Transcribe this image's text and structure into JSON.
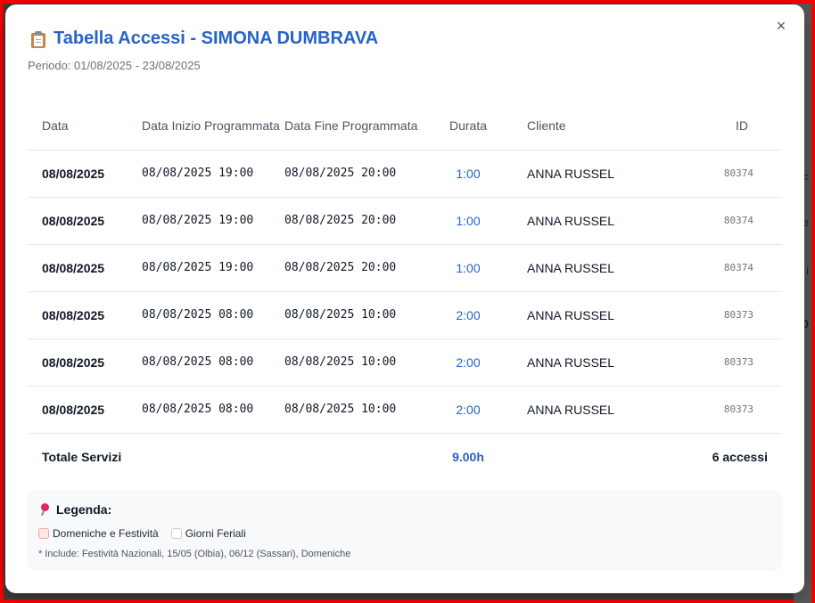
{
  "modal": {
    "title": "Tabella Accessi - SIMONA DUMBRAVA",
    "subtitle": "Periodo: 01/08/2025 - 23/08/2025",
    "close_label": "×"
  },
  "table": {
    "headers": {
      "date": "Data",
      "start": "Data Inizio Programmata",
      "end": "Data Fine Programmata",
      "duration": "Durata",
      "client": "Cliente",
      "id": "ID"
    },
    "rows": [
      {
        "date": "08/08/2025",
        "start": "08/08/2025 19:00",
        "end": "08/08/2025 20:00",
        "duration": "1:00",
        "client": "ANNA RUSSEL",
        "id": "80374"
      },
      {
        "date": "08/08/2025",
        "start": "08/08/2025 19:00",
        "end": "08/08/2025 20:00",
        "duration": "1:00",
        "client": "ANNA RUSSEL",
        "id": "80374"
      },
      {
        "date": "08/08/2025",
        "start": "08/08/2025 19:00",
        "end": "08/08/2025 20:00",
        "duration": "1:00",
        "client": "ANNA RUSSEL",
        "id": "80374"
      },
      {
        "date": "08/08/2025",
        "start": "08/08/2025 08:00",
        "end": "08/08/2025 10:00",
        "duration": "2:00",
        "client": "ANNA RUSSEL",
        "id": "80373"
      },
      {
        "date": "08/08/2025",
        "start": "08/08/2025 08:00",
        "end": "08/08/2025 10:00",
        "duration": "2:00",
        "client": "ANNA RUSSEL",
        "id": "80373"
      },
      {
        "date": "08/08/2025",
        "start": "08/08/2025 08:00",
        "end": "08/08/2025 10:00",
        "duration": "2:00",
        "client": "ANNA RUSSEL",
        "id": "80373"
      }
    ],
    "total": {
      "label": "Totale Servizi",
      "duration": "9.00h",
      "count": "6 accessi"
    }
  },
  "legend": {
    "title": "Legenda:",
    "items": [
      "Domeniche e Festività",
      "Giorni Feriali"
    ],
    "note": "* Include: Festività Nazionali, 15/05 (Olbia), 06/12 (Sassari), Domeniche"
  },
  "colors": {
    "accent": "#2563c9",
    "frame": "#ff0000",
    "holiday_swatch": "#fde8e8"
  },
  "icons": [
    "clipboard-icon",
    "pushpin-icon",
    "close-icon"
  ]
}
